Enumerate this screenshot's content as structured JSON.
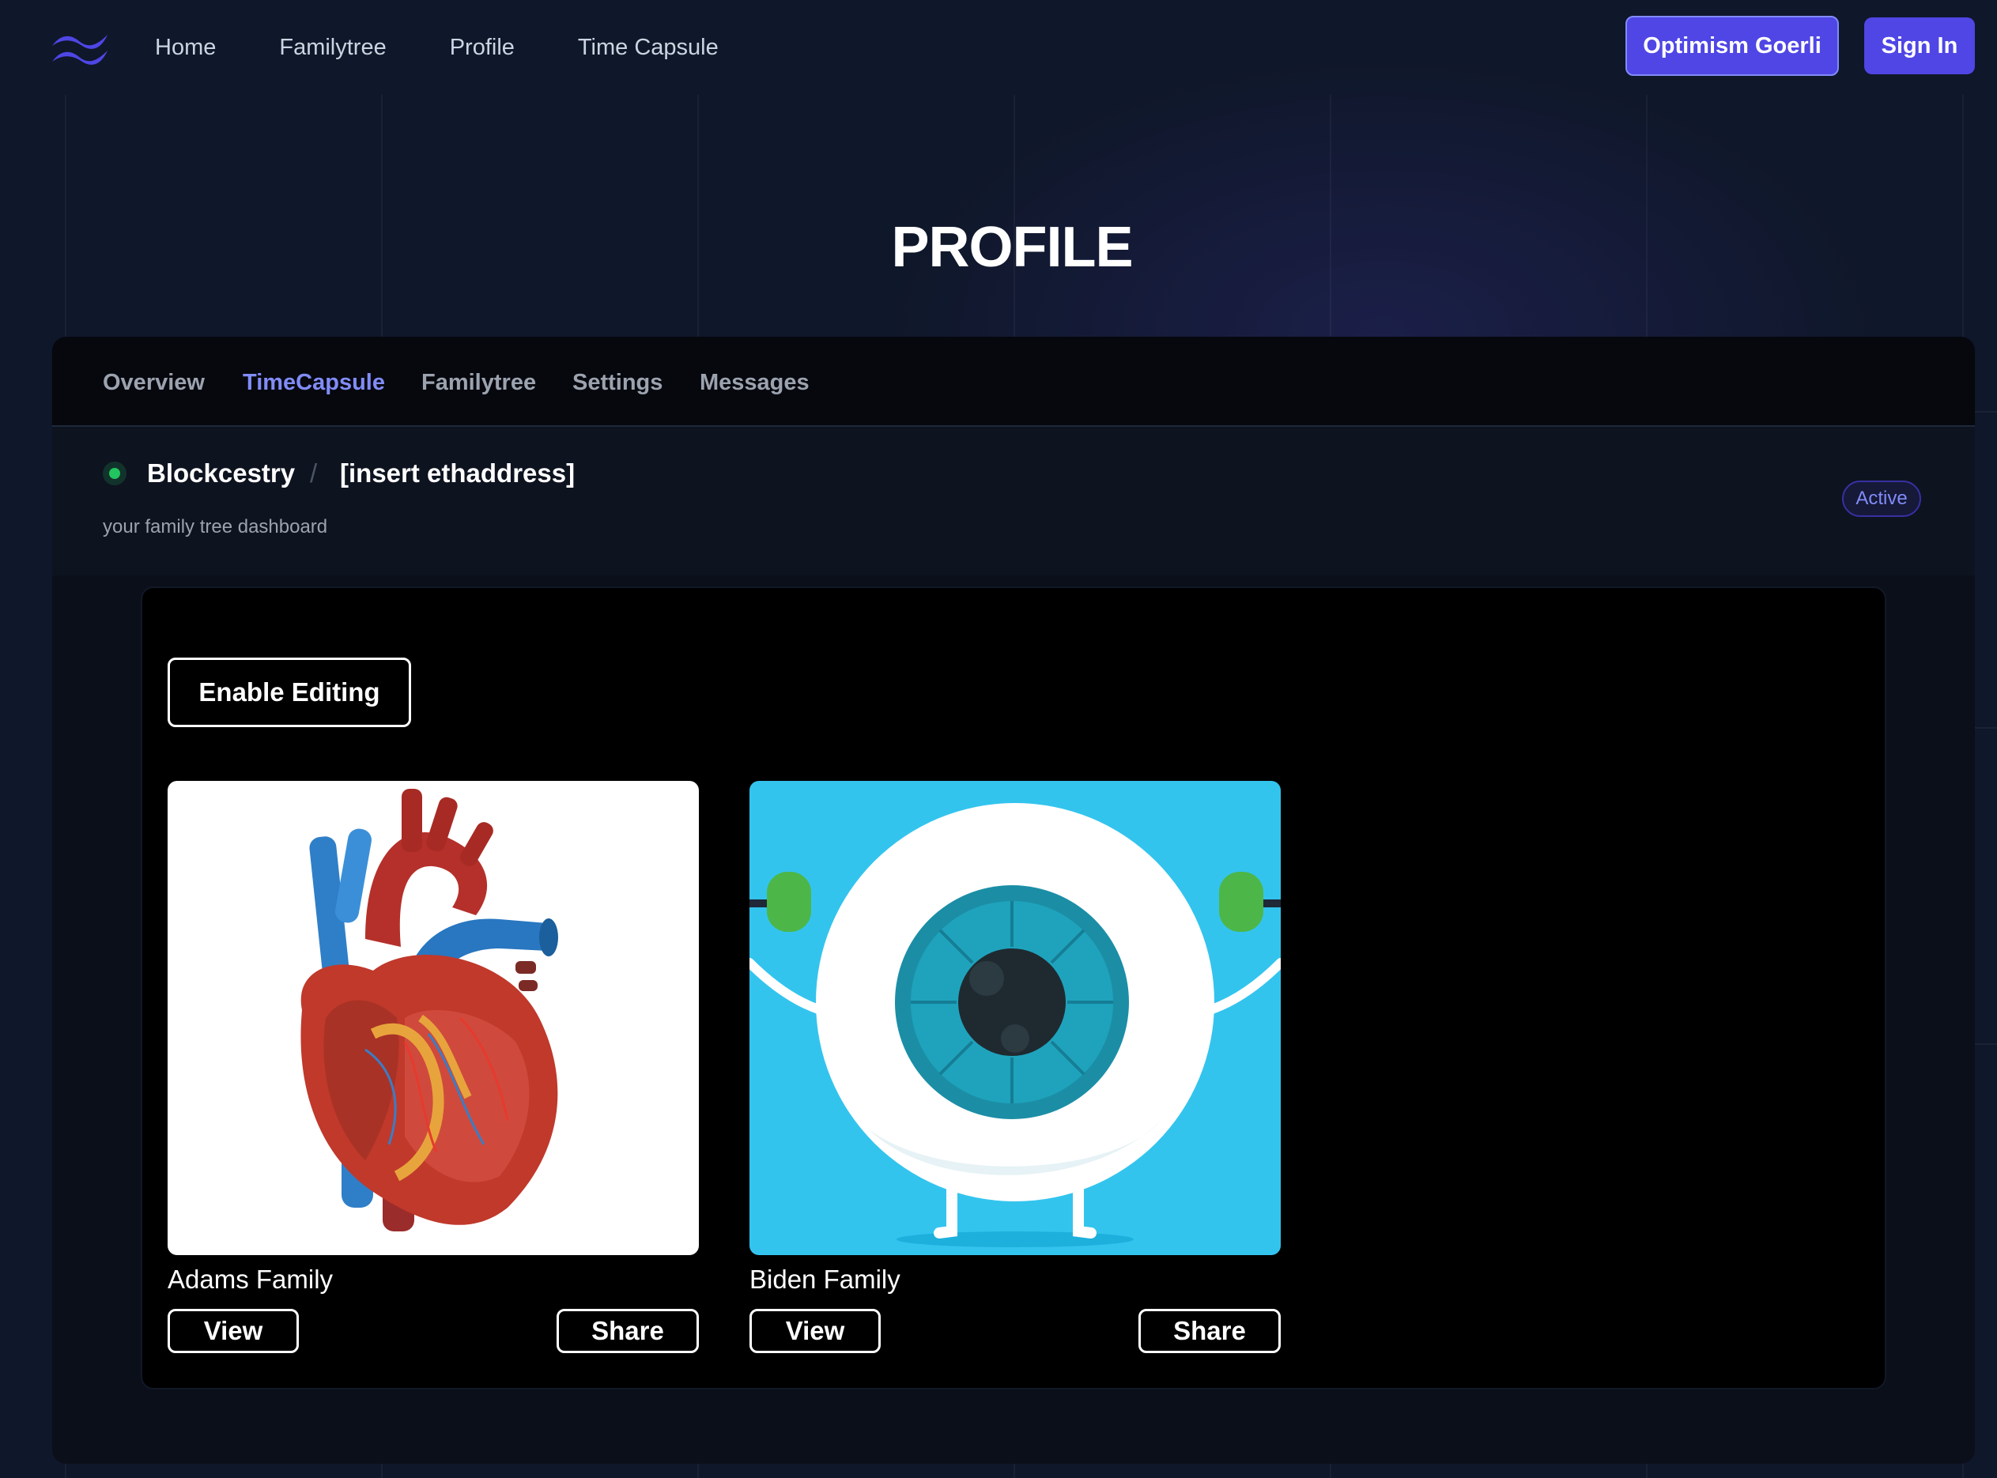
{
  "nav": {
    "links": [
      {
        "label": "Home"
      },
      {
        "label": "Familytree"
      },
      {
        "label": "Profile"
      },
      {
        "label": "Time Capsule"
      }
    ],
    "network_button": "Optimism Goerli",
    "signin_button": "Sign In"
  },
  "page": {
    "title": "PROFILE"
  },
  "tabs": [
    {
      "label": "Overview"
    },
    {
      "label": "TimeCapsule"
    },
    {
      "label": "Familytree"
    },
    {
      "label": "Settings"
    },
    {
      "label": "Messages"
    }
  ],
  "active_tab": "TimeCapsule",
  "header": {
    "project": "Blockcestry",
    "separator": "/",
    "address": "[insert ethaddress]",
    "description": "your family tree dashboard",
    "status_badge": "Active",
    "status_color": "#22c55e"
  },
  "editor": {
    "enable_editing_label": "Enable Editing"
  },
  "cards": [
    {
      "name": "Adams Family",
      "view_label": "View",
      "share_label": "Share",
      "image": "anatomical-heart-illustration"
    },
    {
      "name": "Biden Family",
      "view_label": "View",
      "share_label": "Share",
      "image": "cartoon-eyeball-illustration"
    }
  ],
  "colors": {
    "accent": "#4f46e5",
    "accent_text": "#818cf8",
    "background": "#0f172a"
  }
}
